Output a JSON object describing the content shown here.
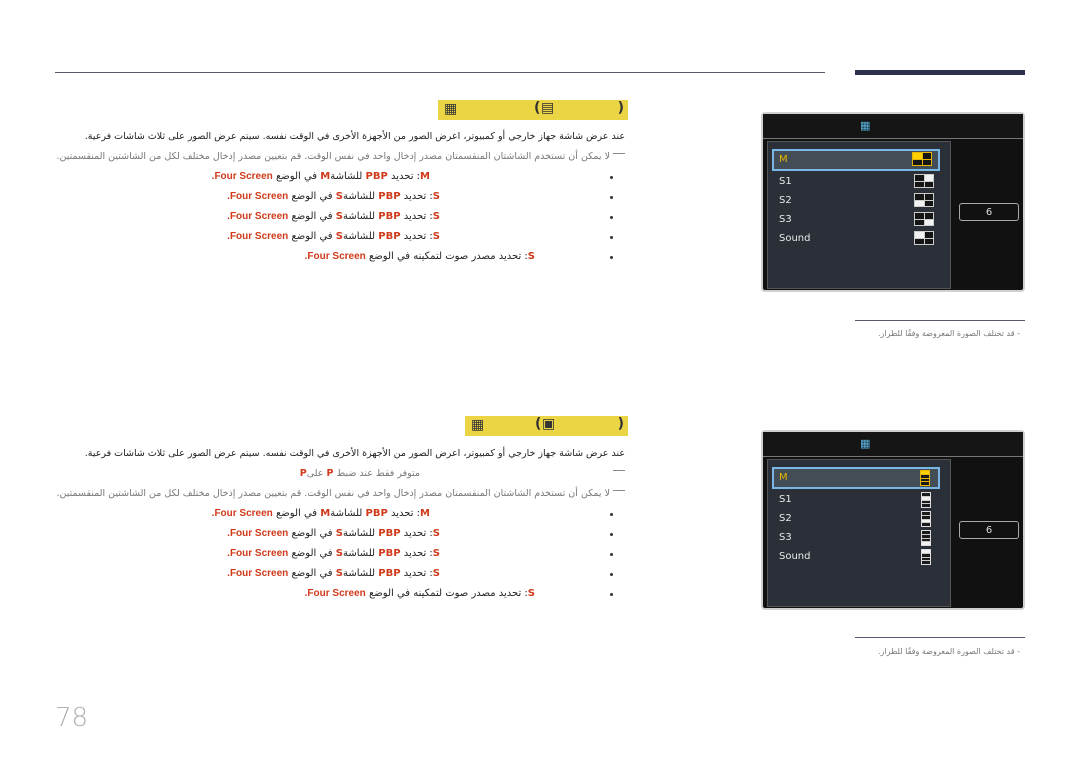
{
  "page": {
    "number": "78"
  },
  "sections": [
    {
      "title": {
        "icon": "PBP-glyph",
        "paren_open": "(",
        "paren_label": "PBP-size-glyph",
        "paren_close": ")"
      },
      "intro": "عند عرض شاشة جهاز خارجي أو كمبيوتر، اعرض الصور من الأجهزة الأخرى في الوقت نفسه. سيتم عرض الصور على ثلاث شاشات فرعية.",
      "notes": [
        "لا يمكن أن تستخدم الشاشتان المنقسمتان مصدر إدخال واحد في نفس الوقت. قم بتعيين مصدر إدخال مختلف لكل من الشاشتين المنقسمتين."
      ],
      "bullets": [
        {
          "key": "M",
          "text": ": تحديد",
          "mid": "PBP",
          "text2": "للشاشة",
          "key2": "M",
          "tail": "في الوضع",
          "mode": "Four Screen."
        },
        {
          "key": "S",
          "text": ": تحديد",
          "mid": "PBP",
          "text2": "للشاشة",
          "key2": "S",
          "tail": "في الوضع",
          "mode": "Four Screen."
        },
        {
          "key": "S",
          "text": ": تحديد",
          "mid": "PBP",
          "text2": "للشاشة",
          "key2": "S",
          "tail": "في الوضع",
          "mode": "Four Screen."
        },
        {
          "key": "S",
          "text": ": تحديد",
          "mid": "PBP",
          "text2": "للشاشة",
          "key2": "S",
          "tail": "في الوضع",
          "mode": "Four Screen."
        },
        {
          "key": "S",
          "text": ": تحديد مصدر صوت لتمكينه في الوضع",
          "mode": "Four Screen."
        }
      ],
      "osd": {
        "header_icon": "PBP",
        "items": [
          {
            "label": "M",
            "selected": true
          },
          {
            "label": "S1",
            "selected": false
          },
          {
            "label": "S2",
            "selected": false
          },
          {
            "label": "S3",
            "selected": false
          },
          {
            "label": "Sound",
            "selected": false
          }
        ],
        "button": "6"
      },
      "footnote": "- قد تختلف الصورة المعروضة وفقًا للطراز."
    },
    {
      "title": {
        "icon": "PBP-glyph",
        "paren_open": "(",
        "paren_label": "PBP-size-glyph",
        "paren_close": ")"
      },
      "intro": "عند عرض شاشة جهاز خارجي أو كمبيوتر، اعرض الصور من الأجهزة الأخرى في الوقت نفسه. سيتم عرض الصور على ثلاث شاشات فرعية.",
      "notes": [
        "متوفر فقط عند ضبط",
        "لا يمكن أن تستخدم الشاشتان المنقسمتان مصدر إدخال واحد في نفس الوقت. قم بتعيين مصدر إدخال مختلف لكل من الشاشتين المنقسمتين."
      ],
      "note_inline": {
        "keys": "P",
        "connector": "على",
        "key2": "P"
      },
      "bullets": [
        {
          "key": "M",
          "text": ": تحديد",
          "mid": "PBP",
          "text2": "للشاشة",
          "key2": "M",
          "tail": "في الوضع",
          "mode": "Four Screen."
        },
        {
          "key": "S",
          "text": ": تحديد",
          "mid": "PBP",
          "text2": "للشاشة",
          "key2": "S",
          "tail": "في الوضع",
          "mode": "Four Screen."
        },
        {
          "key": "S",
          "text": ": تحديد",
          "mid": "PBP",
          "text2": "للشاشة",
          "key2": "S",
          "tail": "في الوضع",
          "mode": "Four Screen."
        },
        {
          "key": "S",
          "text": ": تحديد",
          "mid": "PBP",
          "text2": "للشاشة",
          "key2": "S",
          "tail": "في الوضع",
          "mode": "Four Screen."
        },
        {
          "key": "S",
          "text": ": تحديد مصدر صوت لتمكينه في الوضع",
          "mode": "Four Screen."
        }
      ],
      "osd": {
        "header_icon": "PBP",
        "items": [
          {
            "label": "M",
            "selected": true
          },
          {
            "label": "S1",
            "selected": false
          },
          {
            "label": "S2",
            "selected": false
          },
          {
            "label": "S3",
            "selected": false
          },
          {
            "label": "Sound",
            "selected": false
          }
        ],
        "button": "6"
      },
      "footnote": "- قد تختلف الصورة المعروضة وفقًا للطراز."
    }
  ],
  "colors": {
    "title_bar": "#ecd544",
    "accent_red": "#d03a1a",
    "osd_select": "#e8b500",
    "rule": "#2d3150"
  }
}
